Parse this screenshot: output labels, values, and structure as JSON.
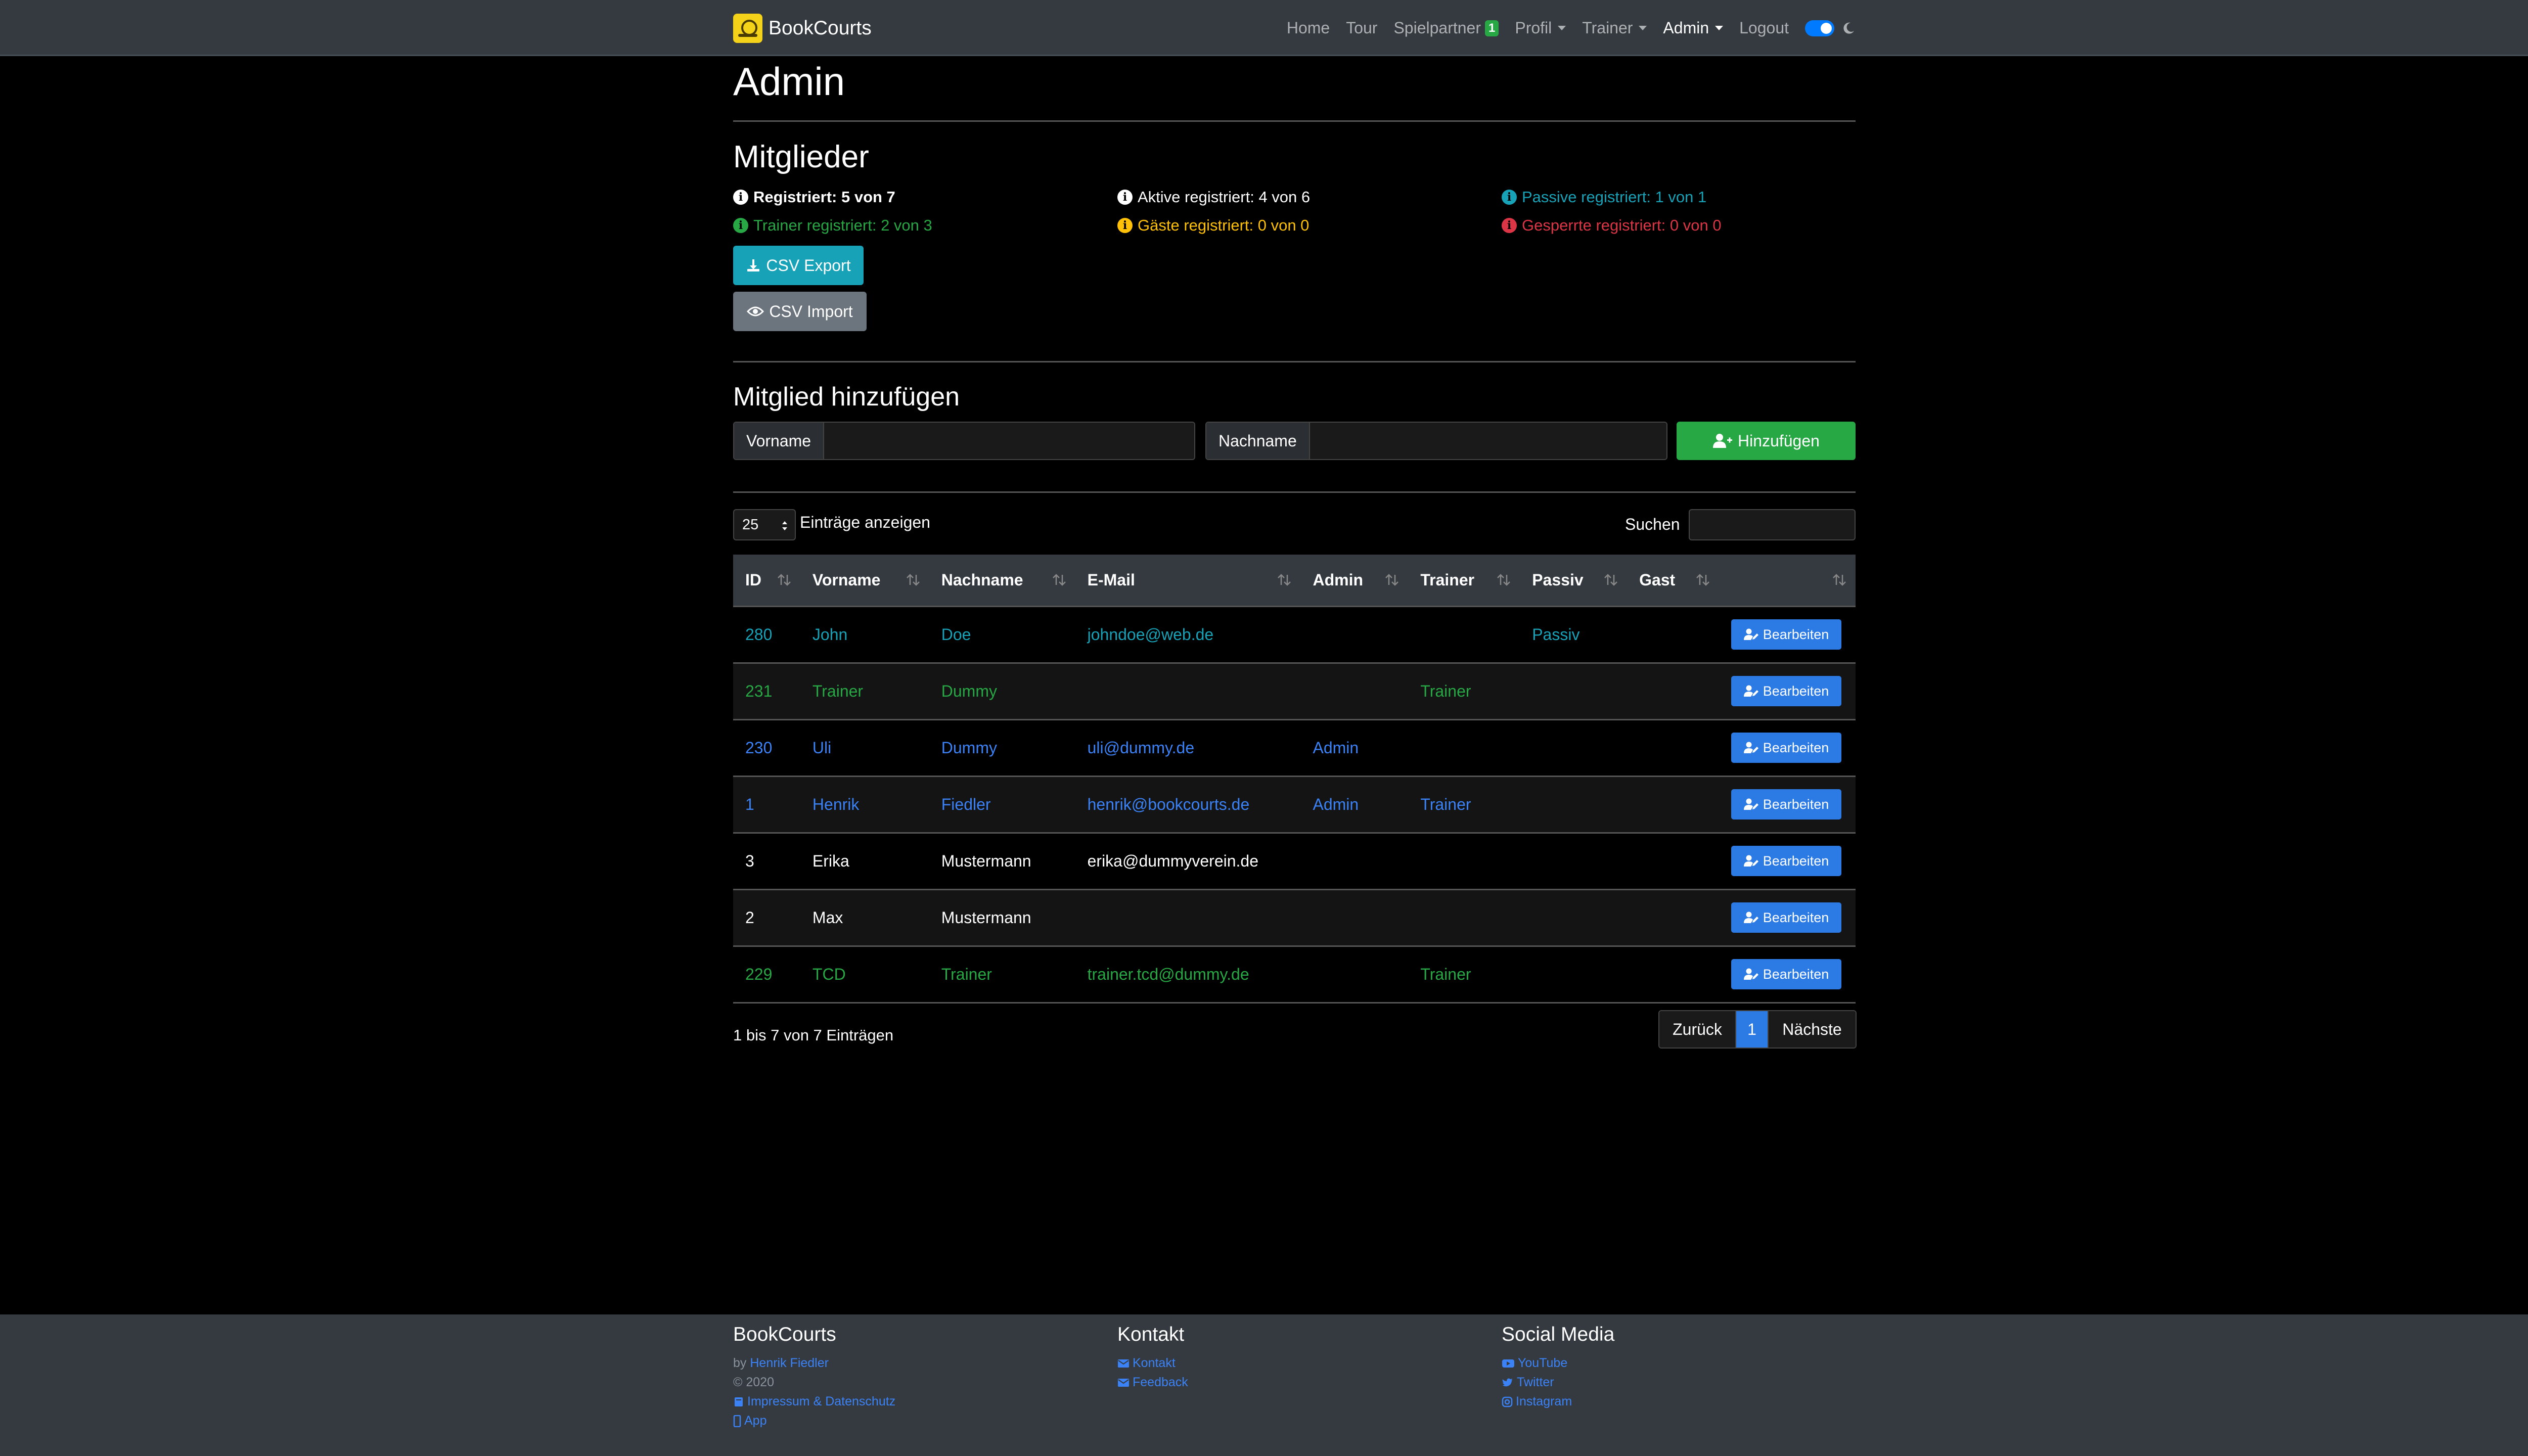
{
  "navbar": {
    "brand": "BookCourts",
    "items": [
      {
        "label": "Home"
      },
      {
        "label": "Tour"
      },
      {
        "label": "Spielpartner",
        "badge": "1"
      },
      {
        "label": "Profil"
      },
      {
        "label": "Trainer"
      },
      {
        "label": "Admin"
      },
      {
        "label": "Logout"
      }
    ]
  },
  "page": {
    "title": "Admin",
    "members_heading": "Mitglieder",
    "stats": {
      "registered": "Registriert: 5 von 7",
      "active": "Aktive registriert: 4 von 6",
      "passive": "Passive registriert: 1 von 1",
      "trainers": "Trainer registriert: 2 von 3",
      "guests": "Gäste registriert: 0 von 0",
      "blocked": "Gesperrte registriert: 0 von 0"
    },
    "csv_export": "CSV Export",
    "csv_import": "CSV Import",
    "add_heading": "Mitglied hinzufügen",
    "firstname_label": "Vorname",
    "lastname_label": "Nachname",
    "add_button": "Hinzufügen"
  },
  "table": {
    "page_size": "25",
    "entries_label": "Einträge anzeigen",
    "search_label": "Suchen",
    "columns": [
      "ID",
      "Vorname",
      "Nachname",
      "E-Mail",
      "Admin",
      "Trainer",
      "Passiv",
      "Gast",
      ""
    ],
    "edit_label": "Bearbeiten",
    "rows": [
      {
        "id": "280",
        "first": "John",
        "last": "Doe",
        "email": "johndoe@web.de",
        "admin": "",
        "trainer": "",
        "passiv": "Passiv",
        "gast": "",
        "color": "#17a2b8"
      },
      {
        "id": "231",
        "first": "Trainer",
        "last": "Dummy",
        "email": "",
        "admin": "",
        "trainer": "Trainer",
        "passiv": "",
        "gast": "",
        "color": "#28a745"
      },
      {
        "id": "230",
        "first": "Uli",
        "last": "Dummy",
        "email": "uli@dummy.de",
        "admin": "Admin",
        "trainer": "",
        "passiv": "",
        "gast": "",
        "color": "#3b82f6"
      },
      {
        "id": "1",
        "first": "Henrik",
        "last": "Fiedler",
        "email": "henrik@bookcourts.de",
        "admin": "Admin",
        "trainer": "Trainer",
        "passiv": "",
        "gast": "",
        "color": "#3b82f6"
      },
      {
        "id": "3",
        "first": "Erika",
        "last": "Mustermann",
        "email": "erika@dummyverein.de",
        "admin": "",
        "trainer": "",
        "passiv": "",
        "gast": "",
        "color": "#ffffff"
      },
      {
        "id": "2",
        "first": "Max",
        "last": "Mustermann",
        "email": "",
        "admin": "",
        "trainer": "",
        "passiv": "",
        "gast": "",
        "color": "#ffffff"
      },
      {
        "id": "229",
        "first": "TCD",
        "last": "Trainer",
        "email": "trainer.tcd@dummy.de",
        "admin": "",
        "trainer": "Trainer",
        "passiv": "",
        "gast": "",
        "color": "#28a745"
      }
    ],
    "info": "1 bis 7 von 7 Einträgen",
    "prev": "Zurück",
    "current_page": "1",
    "next": "Nächste"
  },
  "footer": {
    "brand": "BookCourts",
    "by_prefix": "by",
    "author": "Henrik Fiedler",
    "copyright": "© 2020",
    "impressum": "Impressum & Datenschutz",
    "app": "App",
    "contact_heading": "Kontakt",
    "contact_link": "Kontakt",
    "feedback_link": "Feedback",
    "social_heading": "Social Media",
    "youtube": "YouTube",
    "twitter": "Twitter",
    "instagram": "Instagram"
  },
  "colors": {
    "navbar": "#343a40",
    "info": "#17a2b8",
    "success": "#28a745",
    "warning": "#ffc107",
    "danger": "#dc3545",
    "primary": "#2c7be5"
  }
}
